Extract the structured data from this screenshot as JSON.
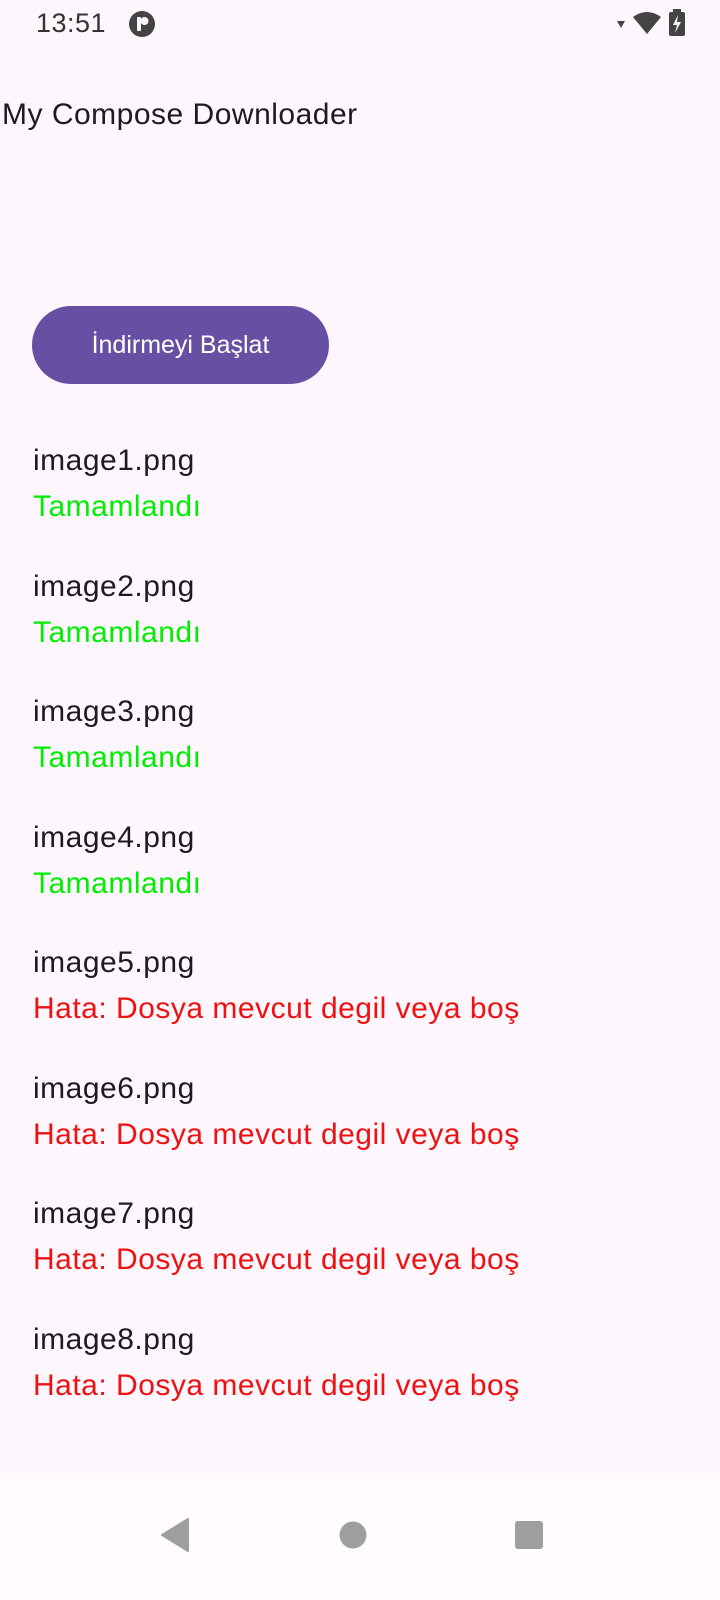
{
  "status_bar": {
    "time": "13:51",
    "app_icon": "app-notification-icon",
    "icons": [
      "signal-icon",
      "wifi-icon",
      "battery-charging-icon"
    ]
  },
  "app": {
    "title": "My Compose Downloader"
  },
  "actions": {
    "start_label": "İndirmeyi Başlat"
  },
  "downloads": [
    {
      "name": "image1.png",
      "status": "Tamamlandı",
      "state": "success"
    },
    {
      "name": "image2.png",
      "status": "Tamamlandı",
      "state": "success"
    },
    {
      "name": "image3.png",
      "status": "Tamamlandı",
      "state": "success"
    },
    {
      "name": "image4.png",
      "status": "Tamamlandı",
      "state": "success"
    },
    {
      "name": "image5.png",
      "status": "Hata: Dosya mevcut degil veya boş",
      "state": "error"
    },
    {
      "name": "image6.png",
      "status": "Hata: Dosya mevcut degil veya boş",
      "state": "error"
    },
    {
      "name": "image7.png",
      "status": "Hata: Dosya mevcut degil veya boş",
      "state": "error"
    },
    {
      "name": "image8.png",
      "status": "Hata: Dosya mevcut degil veya boş",
      "state": "error"
    }
  ],
  "colors": {
    "accent": "#6750a4",
    "success": "#00ee00",
    "error": "#ee1111",
    "background": "#fdf7fd"
  },
  "nav_bar": {
    "buttons": [
      "back-icon",
      "home-icon",
      "recents-icon"
    ]
  }
}
